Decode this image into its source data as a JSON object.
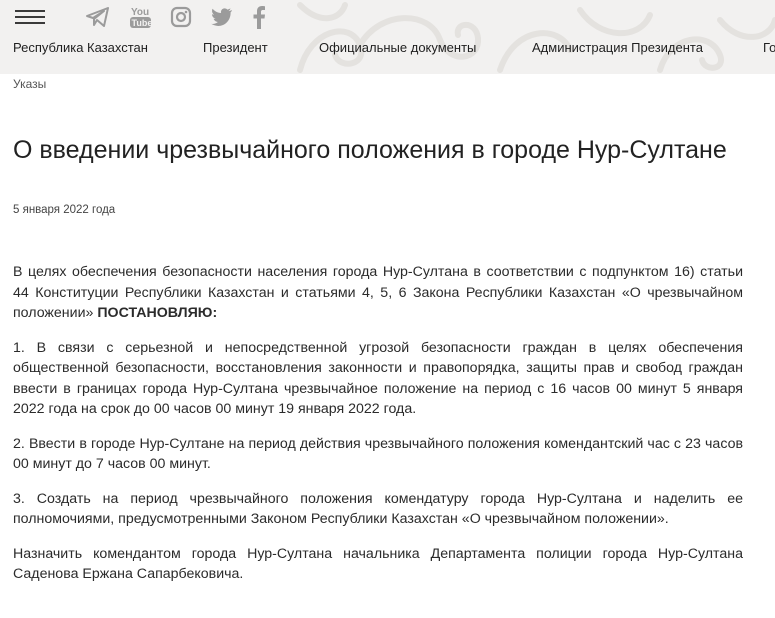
{
  "header": {
    "menu_icon": "hamburger-menu-icon",
    "social": [
      {
        "name": "telegram-icon"
      },
      {
        "name": "youtube-icon",
        "label": "You Tube"
      },
      {
        "name": "instagram-icon"
      },
      {
        "name": "twitter-icon"
      },
      {
        "name": "facebook-icon"
      }
    ],
    "nav": [
      {
        "label": "Республика Казахстан"
      },
      {
        "label": "Президент"
      },
      {
        "label": "Официальные документы"
      },
      {
        "label": "Администрация Президента"
      },
      {
        "label": "Го"
      }
    ],
    "colors": {
      "background": "#f2f1f0",
      "ornament": "#e4e2df",
      "icons": "#9b9b9b"
    }
  },
  "breadcrumb": "Указы",
  "article": {
    "title": "О введении чрезвычайного положения в городе Нур-Султане",
    "date": "5 января 2022 года",
    "intro": "В целях обеспечения безопасности населения города Нур-Султана в соответствии с подпунктом 16) статьи 44 Конституции Республики Казахстан и статьями 4, 5, 6 Закона Республики Казахстан «О чрезвычайном положении»",
    "intro_bold": "ПОСТАНОВЛЯЮ:",
    "paragraphs": [
      "1. В связи с серьезной и непосредственной угрозой безопасности граждан в целях обеспечения общественной безопасности, восстановления законности и правопорядка, защиты прав и свобод граждан ввести в границах города Нур-Султана чрезвычайное положение на период с 16 часов 00 минут 5 января 2022 года на срок до 00 часов 00 минут 19 января 2022 года.",
      "2. Ввести в городе Нур-Султане на период действия чрезвычайного положения комендантский час с 23 часов 00 минут до 7 часов 00 минут.",
      "3. Создать на период чрезвычайного положения комендатуру города Нур-Султана и наделить ее полномочиями, предусмотренными Законом Республики Казахстан «О чрезвычайном положении».",
      "Назначить комендантом города Нур-Султана начальника Департамента полиции города Нур-Султана Саденова Ержана Сапарбековича."
    ]
  }
}
